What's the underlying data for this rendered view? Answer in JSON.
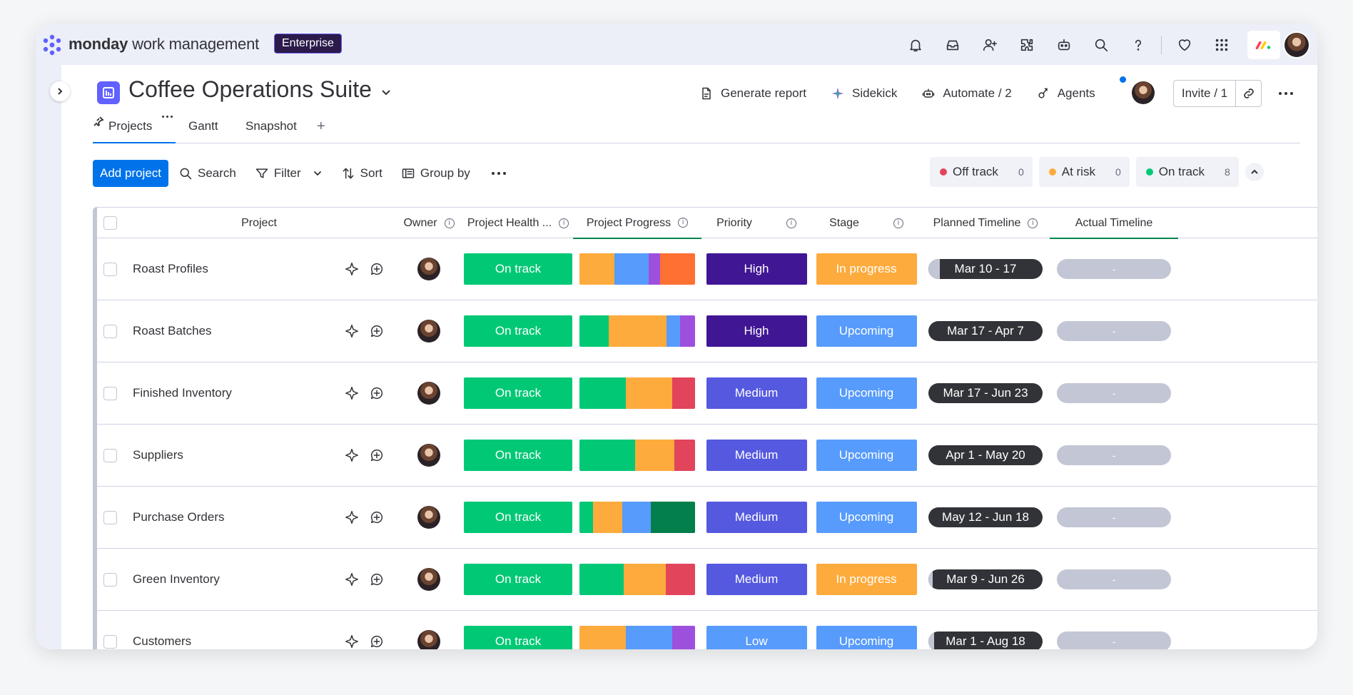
{
  "brand": {
    "bold": "monday",
    "rest": " work management",
    "plan": "Enterprise"
  },
  "board": {
    "title": "Coffee Operations Suite",
    "actions": {
      "report": "Generate report",
      "sidekick": "Sidekick",
      "automate": "Automate / 2",
      "agents": "Agents"
    },
    "invite": "Invite / 1"
  },
  "views": {
    "projects": "Projects",
    "gantt": "Gantt",
    "snapshot": "Snapshot",
    "add": "+"
  },
  "toolbar": {
    "add": "Add project",
    "search": "Search",
    "filter": "Filter",
    "sort": "Sort",
    "group": "Group by"
  },
  "status_summary": [
    {
      "label": "Off track",
      "count": "0",
      "color": "#e2445c"
    },
    {
      "label": "At risk",
      "count": "0",
      "color": "#fdab3d"
    },
    {
      "label": "On track",
      "count": "8",
      "color": "#00c875"
    }
  ],
  "columns": {
    "project": "Project",
    "owner": "Owner",
    "health": "Project Health ...",
    "progress": "Project Progress",
    "priority": "Priority",
    "stage": "Stage",
    "planned": "Planned Timeline",
    "actual": "Actual Timeline"
  },
  "colors": {
    "on_track": "#00c875",
    "high": "#401694",
    "medium": "#5559df",
    "low": "#579bfc",
    "in_progress": "#fdab3d",
    "upcoming": "#579bfc",
    "timeline": "#323338",
    "accent": "#0073ea"
  },
  "rows": [
    {
      "name": "Roast Profiles",
      "health": "On track",
      "priority": "High",
      "priority_color": "#401694",
      "stage": "In progress",
      "stage_color": "#fdab3d",
      "planned": "Mar 10 - 17",
      "planned_elapsed": 0.1,
      "actual": "-",
      "progress": [
        {
          "color": "#fdab3d",
          "share": 0.3
        },
        {
          "color": "#579bfc",
          "share": 0.3
        },
        {
          "color": "#9d50dd",
          "share": 0.1
        },
        {
          "color": "#ff7033",
          "share": 0.3
        }
      ]
    },
    {
      "name": "Roast Batches",
      "health": "On track",
      "priority": "High",
      "priority_color": "#401694",
      "stage": "Upcoming",
      "stage_color": "#579bfc",
      "planned": "Mar 17 - Apr 7",
      "planned_elapsed": 0.0,
      "actual": "-",
      "progress": [
        {
          "color": "#00c875",
          "share": 0.25
        },
        {
          "color": "#fdab3d",
          "share": 0.5
        },
        {
          "color": "#579bfc",
          "share": 0.12
        },
        {
          "color": "#9d50dd",
          "share": 0.13
        }
      ]
    },
    {
      "name": "Finished Inventory",
      "health": "On track",
      "priority": "Medium",
      "priority_color": "#5559df",
      "stage": "Upcoming",
      "stage_color": "#579bfc",
      "planned": "Mar 17 - Jun 23",
      "planned_elapsed": 0.0,
      "actual": "-",
      "progress": [
        {
          "color": "#00c875",
          "share": 0.4
        },
        {
          "color": "#fdab3d",
          "share": 0.4
        },
        {
          "color": "#e2445c",
          "share": 0.2
        }
      ]
    },
    {
      "name": "Suppliers",
      "health": "On track",
      "priority": "Medium",
      "priority_color": "#5559df",
      "stage": "Upcoming",
      "stage_color": "#579bfc",
      "planned": "Apr 1 - May 20",
      "planned_elapsed": 0.0,
      "actual": "-",
      "progress": [
        {
          "color": "#00c875",
          "share": 0.48
        },
        {
          "color": "#fdab3d",
          "share": 0.34
        },
        {
          "color": "#e2445c",
          "share": 0.18
        }
      ]
    },
    {
      "name": "Purchase Orders",
      "health": "On track",
      "priority": "Medium",
      "priority_color": "#5559df",
      "stage": "Upcoming",
      "stage_color": "#579bfc",
      "planned": "May 12 - Jun 18",
      "planned_elapsed": 0.0,
      "actual": "-",
      "progress": [
        {
          "color": "#00c875",
          "share": 0.12
        },
        {
          "color": "#fdab3d",
          "share": 0.25
        },
        {
          "color": "#579bfc",
          "share": 0.25
        },
        {
          "color": "#037f4c",
          "share": 0.38
        }
      ]
    },
    {
      "name": "Green Inventory",
      "health": "On track",
      "priority": "Medium",
      "priority_color": "#5559df",
      "stage": "In progress",
      "stage_color": "#fdab3d",
      "planned": "Mar 9 - Jun 26",
      "planned_elapsed": 0.04,
      "actual": "-",
      "progress": [
        {
          "color": "#00c875",
          "share": 0.38
        },
        {
          "color": "#fdab3d",
          "share": 0.37
        },
        {
          "color": "#e2445c",
          "share": 0.25
        }
      ]
    },
    {
      "name": "Customers",
      "health": "On track",
      "priority": "Low",
      "priority_color": "#579bfc",
      "stage": "Upcoming",
      "stage_color": "#579bfc",
      "planned": "Mar 1 - Aug 18",
      "planned_elapsed": 0.05,
      "actual": "-",
      "progress": [
        {
          "color": "#fdab3d",
          "share": 0.4
        },
        {
          "color": "#579bfc",
          "share": 0.4
        },
        {
          "color": "#9d50dd",
          "share": 0.2
        }
      ]
    }
  ]
}
